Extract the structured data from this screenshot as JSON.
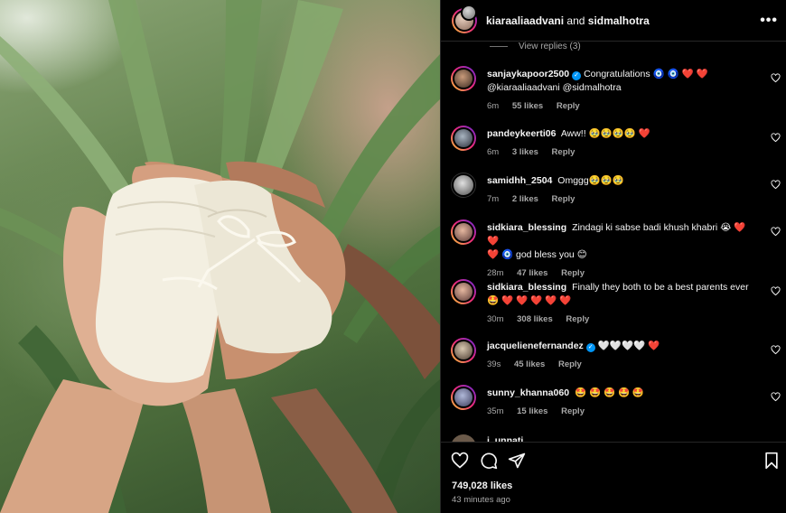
{
  "post": {
    "header": {
      "user1": "kiaraaliaadvani",
      "and": "and",
      "user2": "sidmalhotra",
      "more": "•••"
    },
    "view_replies": "View replies (3)",
    "comments": [
      {
        "user": "sanjaykapoor2500",
        "verified": true,
        "text": "Congratulations 🧿 🧿 ❤️ ❤️",
        "text2": "@kiaraaliaadvani @sidmalhotra",
        "time": "6m",
        "likes": "55 likes",
        "reply": "Reply"
      },
      {
        "user": "pandeykeerti06",
        "verified": false,
        "text": "Aww!! 🥹🥹🥹🥹 ❤️",
        "time": "6m",
        "likes": "3 likes",
        "reply": "Reply"
      },
      {
        "user": "samidhh_2504",
        "verified": false,
        "text": "Omggg🥹🥹🥹",
        "time": "7m",
        "likes": "2 likes",
        "reply": "Reply"
      },
      {
        "user": "sidkiara_blessing",
        "verified": false,
        "text": "Zindagi ki sabse badi khush khabri 😭 ❤️ ❤️",
        "text2": "❤️ 🧿 god bless you 😊",
        "time": "28m",
        "likes": "47 likes",
        "reply": "Reply"
      },
      {
        "user": "sidkiara_blessing",
        "verified": false,
        "text": "Finally they both to be a best parents ever",
        "text2": "🤩 ❤️ ❤️ ❤️ ❤️ ❤️",
        "time": "30m",
        "likes": "308 likes",
        "reply": "Reply"
      },
      {
        "user": "jacquelienefernandez",
        "verified": true,
        "text": "🤍🤍🤍🤍 ❤️",
        "time": "39s",
        "likes": "45 likes",
        "reply": "Reply"
      },
      {
        "user": "sunny_khanna060",
        "verified": false,
        "text": "🤩 🤩 🤩 🤩 🤩",
        "time": "35m",
        "likes": "15 likes",
        "reply": "Reply"
      }
    ],
    "partial_user": "i_unnati",
    "likes_count": "749,028 likes",
    "time_ago": "43 minutes ago"
  },
  "colors": {
    "background": "#000000",
    "text": "#f5f5f5",
    "muted": "#a8a8a8",
    "verified": "#0095f6",
    "heart_red": "#ff3040"
  }
}
